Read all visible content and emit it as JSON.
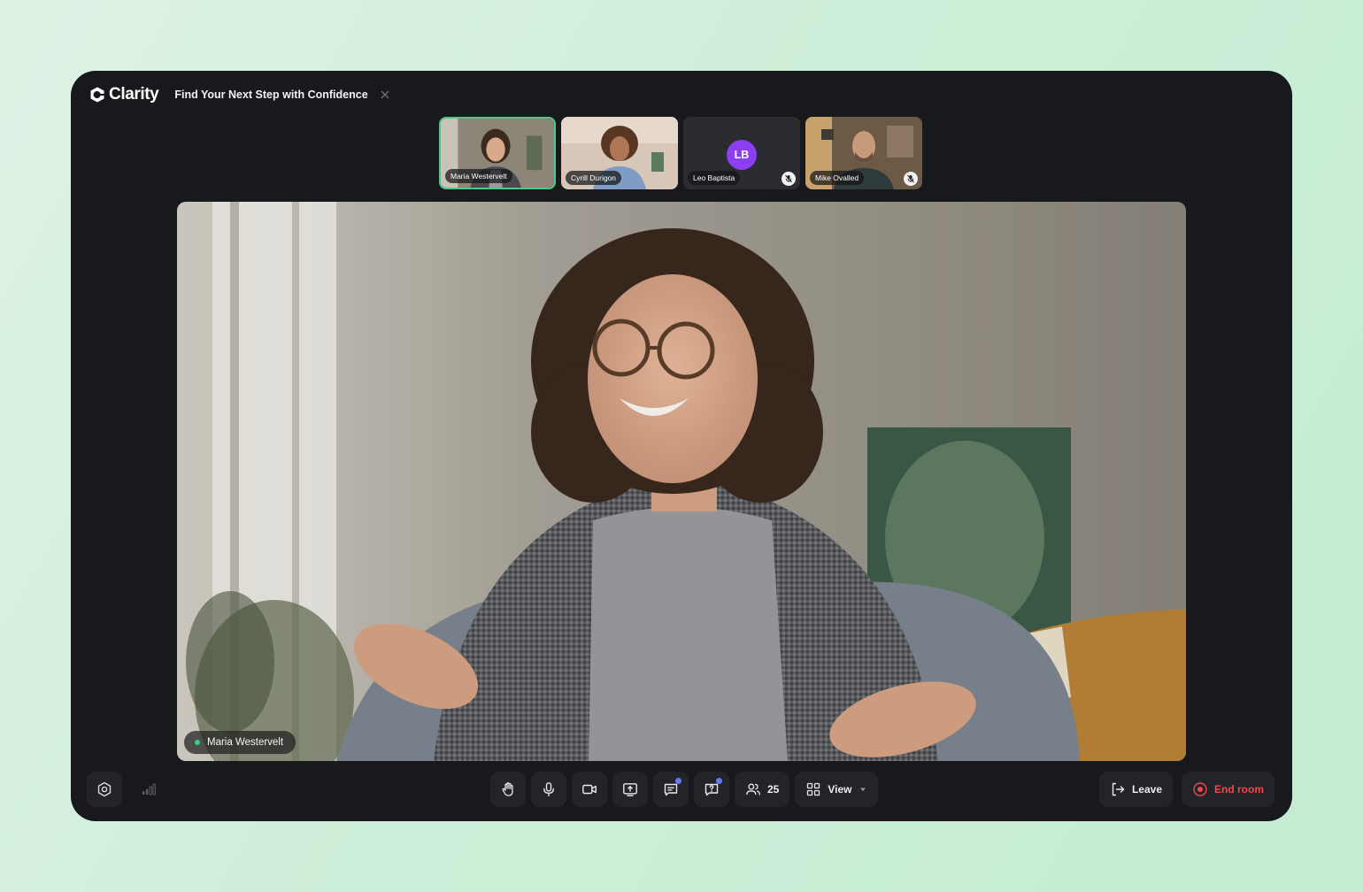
{
  "app": {
    "name": "Clarity",
    "logo_icon": "clarity-logo-icon"
  },
  "meeting": {
    "title": "Find Your Next Step with Confidence"
  },
  "participants": [
    {
      "name": "Maria Westervelt",
      "active": true,
      "muted": false
    },
    {
      "name": "Cyrill Durigon",
      "active": false,
      "muted": false
    },
    {
      "name": "Leo Baptista",
      "initials": "LB",
      "active": false,
      "muted": true,
      "avatar_color": "#8b3ff0"
    },
    {
      "name": "Mike Ovalled",
      "active": false,
      "muted": true
    }
  ],
  "main_speaker": {
    "name": "Maria Westervelt",
    "status_color": "#37d17a"
  },
  "toolbar": {
    "left": [
      "settings-icon",
      "signal-strength-icon"
    ],
    "center": [
      "raise-hand-icon",
      "microphone-icon",
      "camera-icon",
      "share-screen-icon",
      "chat-icon",
      "questions-icon"
    ],
    "participants_count": "25",
    "view_label": "View",
    "leave_label": "Leave",
    "end_room_label": "End room"
  },
  "colors": {
    "accent": "#4cc98a",
    "danger": "#f04848",
    "notification": "#5b7cff"
  }
}
